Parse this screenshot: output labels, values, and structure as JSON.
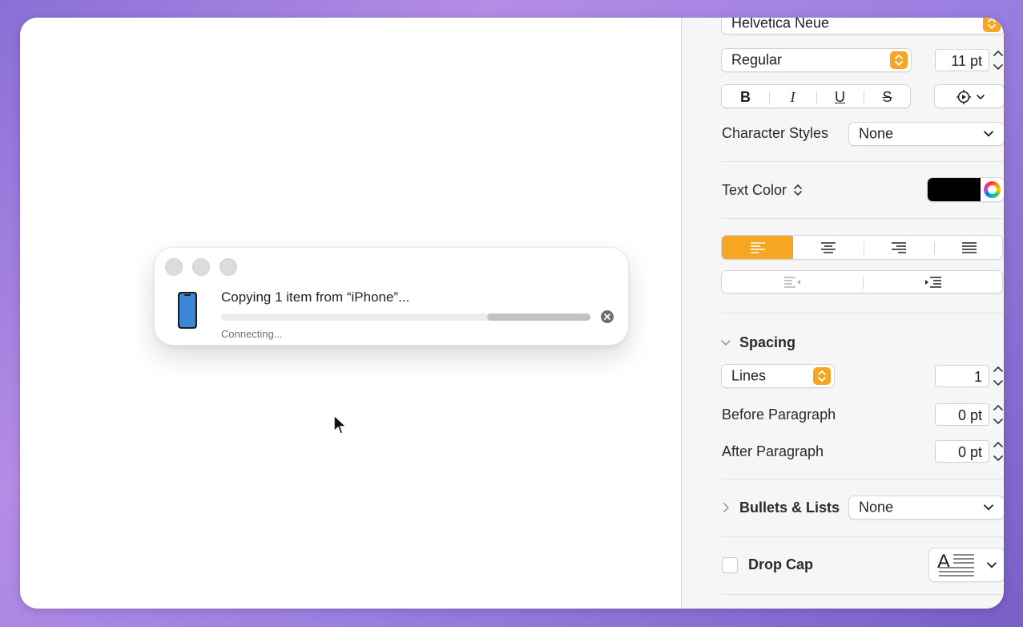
{
  "dialog": {
    "title": "Copying 1 item from “iPhone”...",
    "status": "Connecting...",
    "progress_indeterminate_fraction": 0.28
  },
  "sidebar": {
    "font_family_value": "Helvetica Neue",
    "font_style_value": "Regular",
    "font_size_value": "11 pt",
    "format_buttons": {
      "bold": "B",
      "italic": "I",
      "underline": "U",
      "strike": "S"
    },
    "character_styles_label": "Character Styles",
    "character_styles_value": "None",
    "text_color_label": "Text Color",
    "text_color_value": "#000000",
    "alignment_selected": "left",
    "spacing_label": "Spacing",
    "spacing_mode_value": "Lines",
    "spacing_value": "1",
    "before_paragraph_label": "Before Paragraph",
    "before_paragraph_value": "0 pt",
    "after_paragraph_label": "After Paragraph",
    "after_paragraph_value": "0 pt",
    "bullets_label": "Bullets & Lists",
    "bullets_value": "None",
    "drop_cap_label": "Drop Cap",
    "drop_cap_glyph": "A",
    "accent_color": "#f5a623"
  }
}
